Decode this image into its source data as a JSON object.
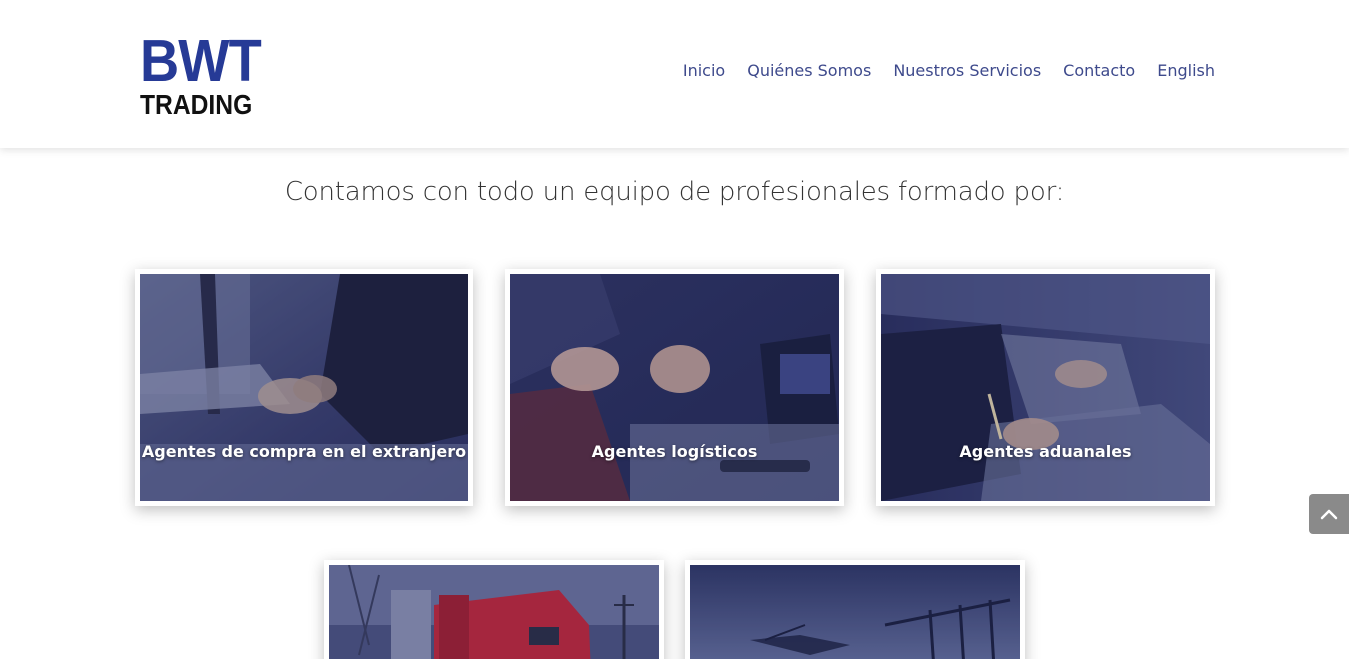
{
  "header": {
    "logo": {
      "line1": "BWT",
      "line2": "TRADING"
    },
    "nav": [
      {
        "label": "Inicio"
      },
      {
        "label": "Quiénes Somos"
      },
      {
        "label": "Nuestros Servicios"
      },
      {
        "label": "Contacto"
      },
      {
        "label": "English"
      }
    ]
  },
  "intro": {
    "text": "Contamos con todo un equipo de profesionales formado por:"
  },
  "cards": [
    {
      "title": "Agentes de compra en el extranjero",
      "image_icon": "handshake-photo"
    },
    {
      "title": "Agentes logísticos",
      "image_icon": "meeting-photo"
    },
    {
      "title": "Agentes aduanales",
      "image_icon": "signing-photo"
    },
    {
      "title": "",
      "image_icon": "truck-photo"
    },
    {
      "title": "",
      "image_icon": "port-cranes-photo"
    }
  ],
  "colors": {
    "brand_blue": "#263a96",
    "nav_text": "#3e4a8c",
    "overlay": "#1e2450"
  },
  "scroll_top": {
    "icon": "chevron-up-icon"
  }
}
